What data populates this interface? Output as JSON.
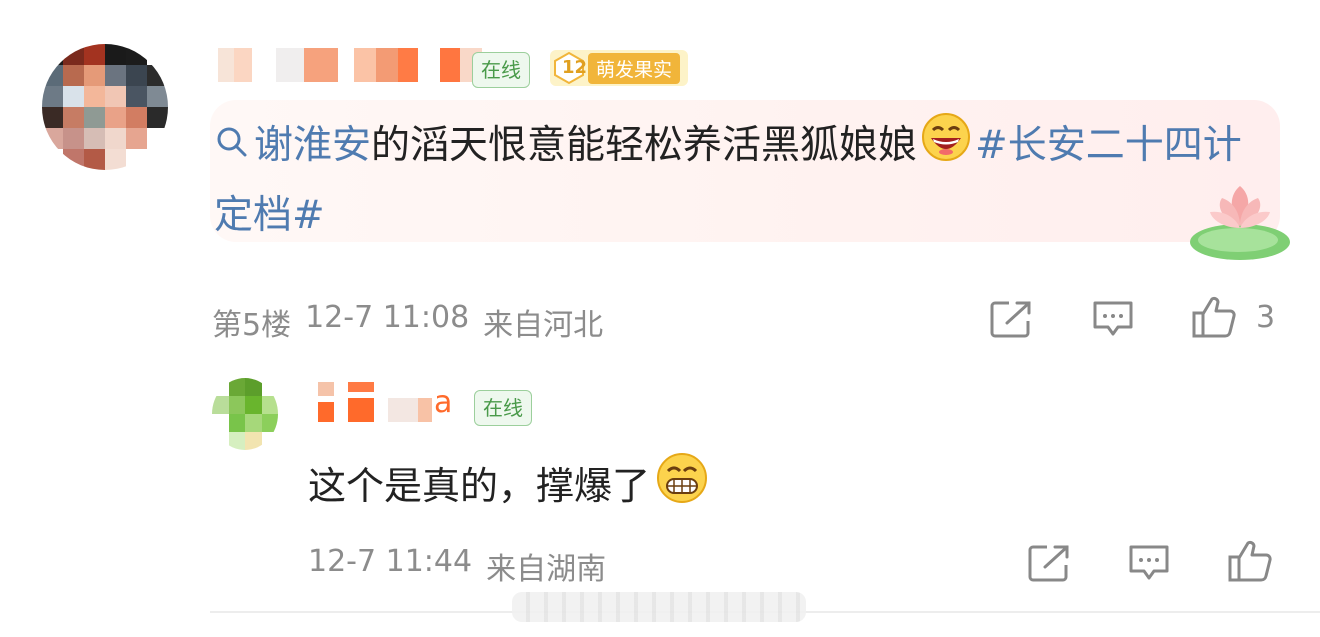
{
  "comment": {
    "online_badge": "在线",
    "level_badge": {
      "number": "12",
      "label": "萌发果实"
    },
    "search_prefix_icon": "search-icon",
    "text_link": "谢淮安",
    "text_body": "的滔天恨意能轻松养活黑狐娘娘",
    "emoji1": "laughing-face",
    "hashtag": "#长安二十四计定档#",
    "meta": {
      "floor": "第5楼",
      "date": "12-7 11:08",
      "location": "来自河北"
    },
    "actions": {
      "share_icon": "share-icon",
      "reply_icon": "comment-icon",
      "like_icon": "thumbs-up-icon",
      "like_count": "3"
    }
  },
  "reply": {
    "name_suffix": "a",
    "online_badge": "在线",
    "text": "这个是真的，撑爆了",
    "emoji": "grinning-face",
    "meta": {
      "date": "12-7 11:44",
      "location": "来自湖南"
    },
    "actions": {
      "share_icon": "share-icon",
      "reply_icon": "comment-icon",
      "like_icon": "thumbs-up-icon"
    }
  },
  "colors": {
    "link": "#4f7bb0",
    "meta_gray": "#8c8c8c",
    "online_green": "#4a9a4a",
    "level_gold": "#f1b53a"
  }
}
